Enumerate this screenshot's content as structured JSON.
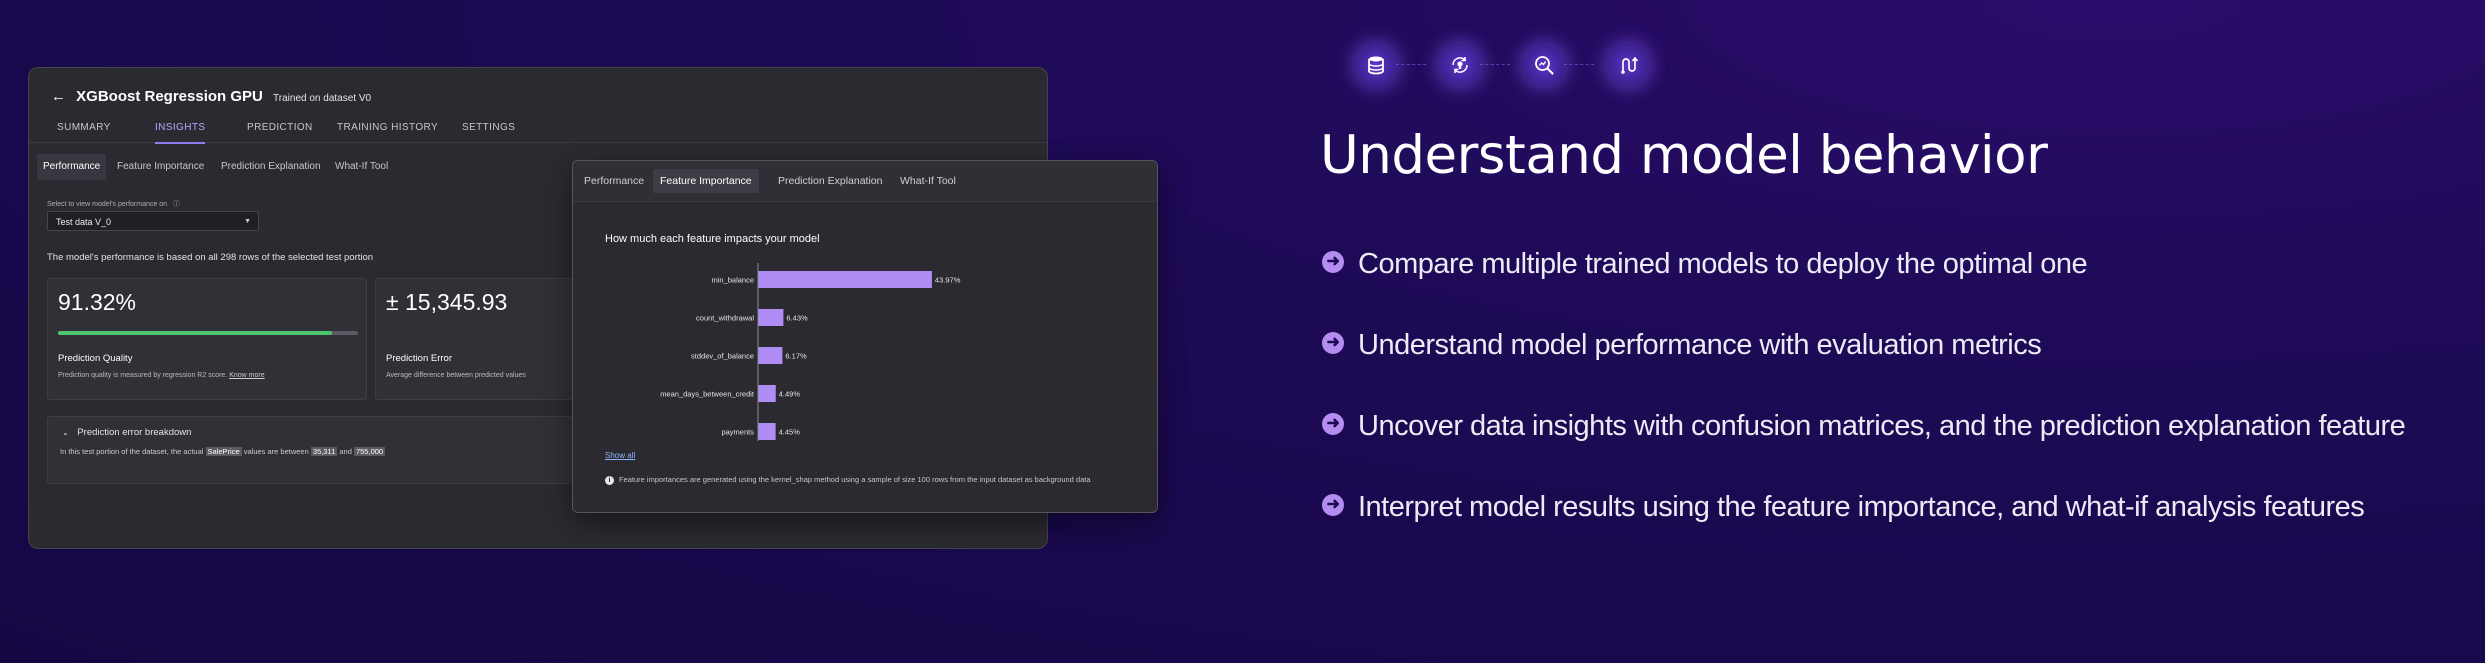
{
  "window": {
    "back_icon": "←",
    "title": "XGBoost Regression GPU",
    "subtitle": "Trained on dataset V0",
    "top_tabs": [
      "SUMMARY",
      "INSIGHTS",
      "PREDICTION",
      "TRAINING HISTORY",
      "SETTINGS"
    ],
    "active_top_tab": "INSIGHTS",
    "sub_tabs": [
      "Performance",
      "Feature Importance",
      "Prediction Explanation",
      "What-If Tool"
    ],
    "active_sub_tab": "Performance",
    "select_label": "Select to view model's performance on",
    "select_value": "Test data V_0",
    "performance_note": "The model's performance is based on all 298 rows of the selected test portion",
    "quality_card": {
      "value": "91.32%",
      "progress": 0.9132,
      "label": "Prediction Quality",
      "desc": "Prediction quality is measured by regression R2 score.",
      "link": "Know more"
    },
    "error_card": {
      "value": "± 15,345.93",
      "label": "Prediction Error",
      "desc": "Average difference between predicted values"
    },
    "breakdown": {
      "title": "Prediction error breakdown",
      "text_before": "In this test portion of the dataset, the actual",
      "column": "SalePrice",
      "text_middle": "values are between",
      "low": "35,311",
      "and": "and",
      "high": "755,000"
    }
  },
  "popup": {
    "tabs": [
      "Performance",
      "Feature Importance",
      "Prediction Explanation",
      "What-If Tool"
    ],
    "active_tab": "Feature Importance",
    "heading": "How much each feature impacts your model",
    "show_all": "Show all",
    "note": "Feature importances are generated using the kernel_shap method using a sample of size 100 rows from the input dataset as background data"
  },
  "chart_data": {
    "type": "bar",
    "orientation": "horizontal",
    "categories": [
      "min_balance",
      "count_withdrawal",
      "stddev_of_balance",
      "mean_days_between_credit",
      "payments"
    ],
    "values": [
      43.97,
      6.43,
      6.17,
      4.49,
      4.45
    ],
    "value_labels": [
      "43.97%",
      "6.43%",
      "6.17%",
      "4.49%",
      "4.45%"
    ],
    "bar_color": "#b08cf5",
    "title": "How much each feature impacts your model"
  },
  "marketing": {
    "icons": [
      "database-icon",
      "refresh-bulb-icon",
      "search-analytics-icon",
      "flow-icon"
    ],
    "headline": "Understand model behavior",
    "bullets": [
      "Compare multiple trained models to deploy the optimal one",
      "Understand model performance with evaluation metrics",
      "Uncover data insights with confusion matrices, and the prediction explanation feature",
      "Interpret model results using the feature importance, and what-if analysis features"
    ],
    "accent": "#b58cf0",
    "background": "#1d0a55"
  }
}
